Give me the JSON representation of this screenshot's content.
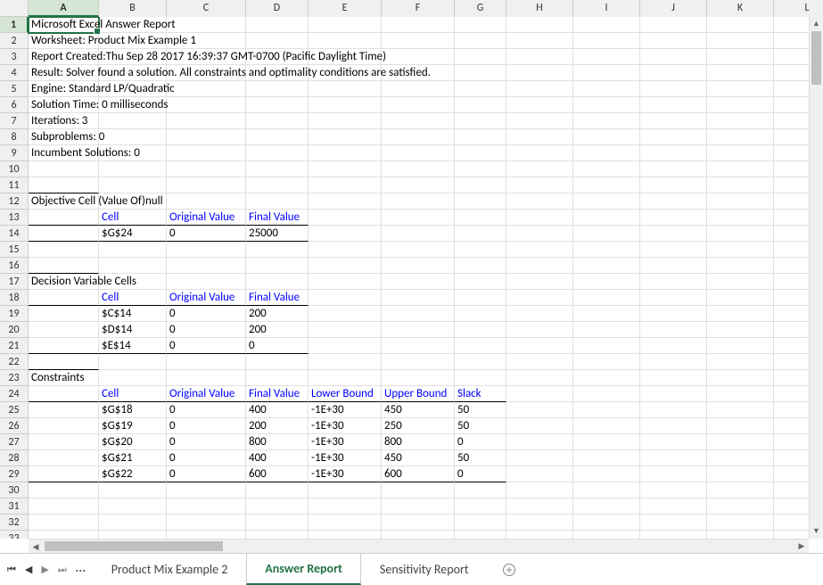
{
  "columns": [
    "A",
    "B",
    "C",
    "D",
    "E",
    "F",
    "G",
    "H",
    "I",
    "J",
    "K",
    "L"
  ],
  "activeCol": "A",
  "activeRow": 1,
  "report": {
    "title": "Microsoft Excel Answer Report",
    "worksheet": "Worksheet: Product Mix Example 1",
    "created": "Report Created:Thu Sep 28 2017 16:39:37 GMT-0700 (Pacific Daylight Time)",
    "result": "Result: Solver found a solution.  All constraints and optimality conditions are satisfied.",
    "engine": "Engine: Standard LP/Quadratic",
    "solutionTime": "Solution Time: 0 milliseconds",
    "iterations": "Iterations: 3",
    "subproblems": "Subproblems: 0",
    "incumbent": "Incumbent Solutions: 0"
  },
  "objective": {
    "header": "Objective Cell (Value Of)null",
    "cols": {
      "cell": "Cell",
      "orig": "Original Value",
      "final": "Final Value"
    },
    "rows": [
      {
        "cell": "$G$24",
        "orig": "0",
        "final": "25000"
      }
    ]
  },
  "decision": {
    "header": "Decision Variable Cells",
    "cols": {
      "cell": "Cell",
      "orig": "Original Value",
      "final": "Final Value"
    },
    "rows": [
      {
        "cell": "$C$14",
        "orig": "0",
        "final": "200"
      },
      {
        "cell": "$D$14",
        "orig": "0",
        "final": "200"
      },
      {
        "cell": "$E$14",
        "orig": "0",
        "final": "0"
      }
    ]
  },
  "constraints": {
    "header": "Constraints",
    "cols": {
      "cell": "Cell",
      "orig": "Original Value",
      "final": "Final Value",
      "lower": "Lower Bound",
      "upper": "Upper Bound",
      "slack": "Slack"
    },
    "rows": [
      {
        "cell": "$G$18",
        "orig": "0",
        "final": "400",
        "lower": "-1E+30",
        "upper": "450",
        "slack": "50"
      },
      {
        "cell": "$G$19",
        "orig": "0",
        "final": "200",
        "lower": "-1E+30",
        "upper": "250",
        "slack": "50"
      },
      {
        "cell": "$G$20",
        "orig": "0",
        "final": "800",
        "lower": "-1E+30",
        "upper": "800",
        "slack": "0"
      },
      {
        "cell": "$G$21",
        "orig": "0",
        "final": "400",
        "lower": "-1E+30",
        "upper": "450",
        "slack": "50"
      },
      {
        "cell": "$G$22",
        "orig": "0",
        "final": "600",
        "lower": "-1E+30",
        "upper": "600",
        "slack": "0"
      }
    ]
  },
  "tabs": {
    "prev": "Product Mix Example 2",
    "active": "Answer Report",
    "next": "Sensitivity Report"
  }
}
